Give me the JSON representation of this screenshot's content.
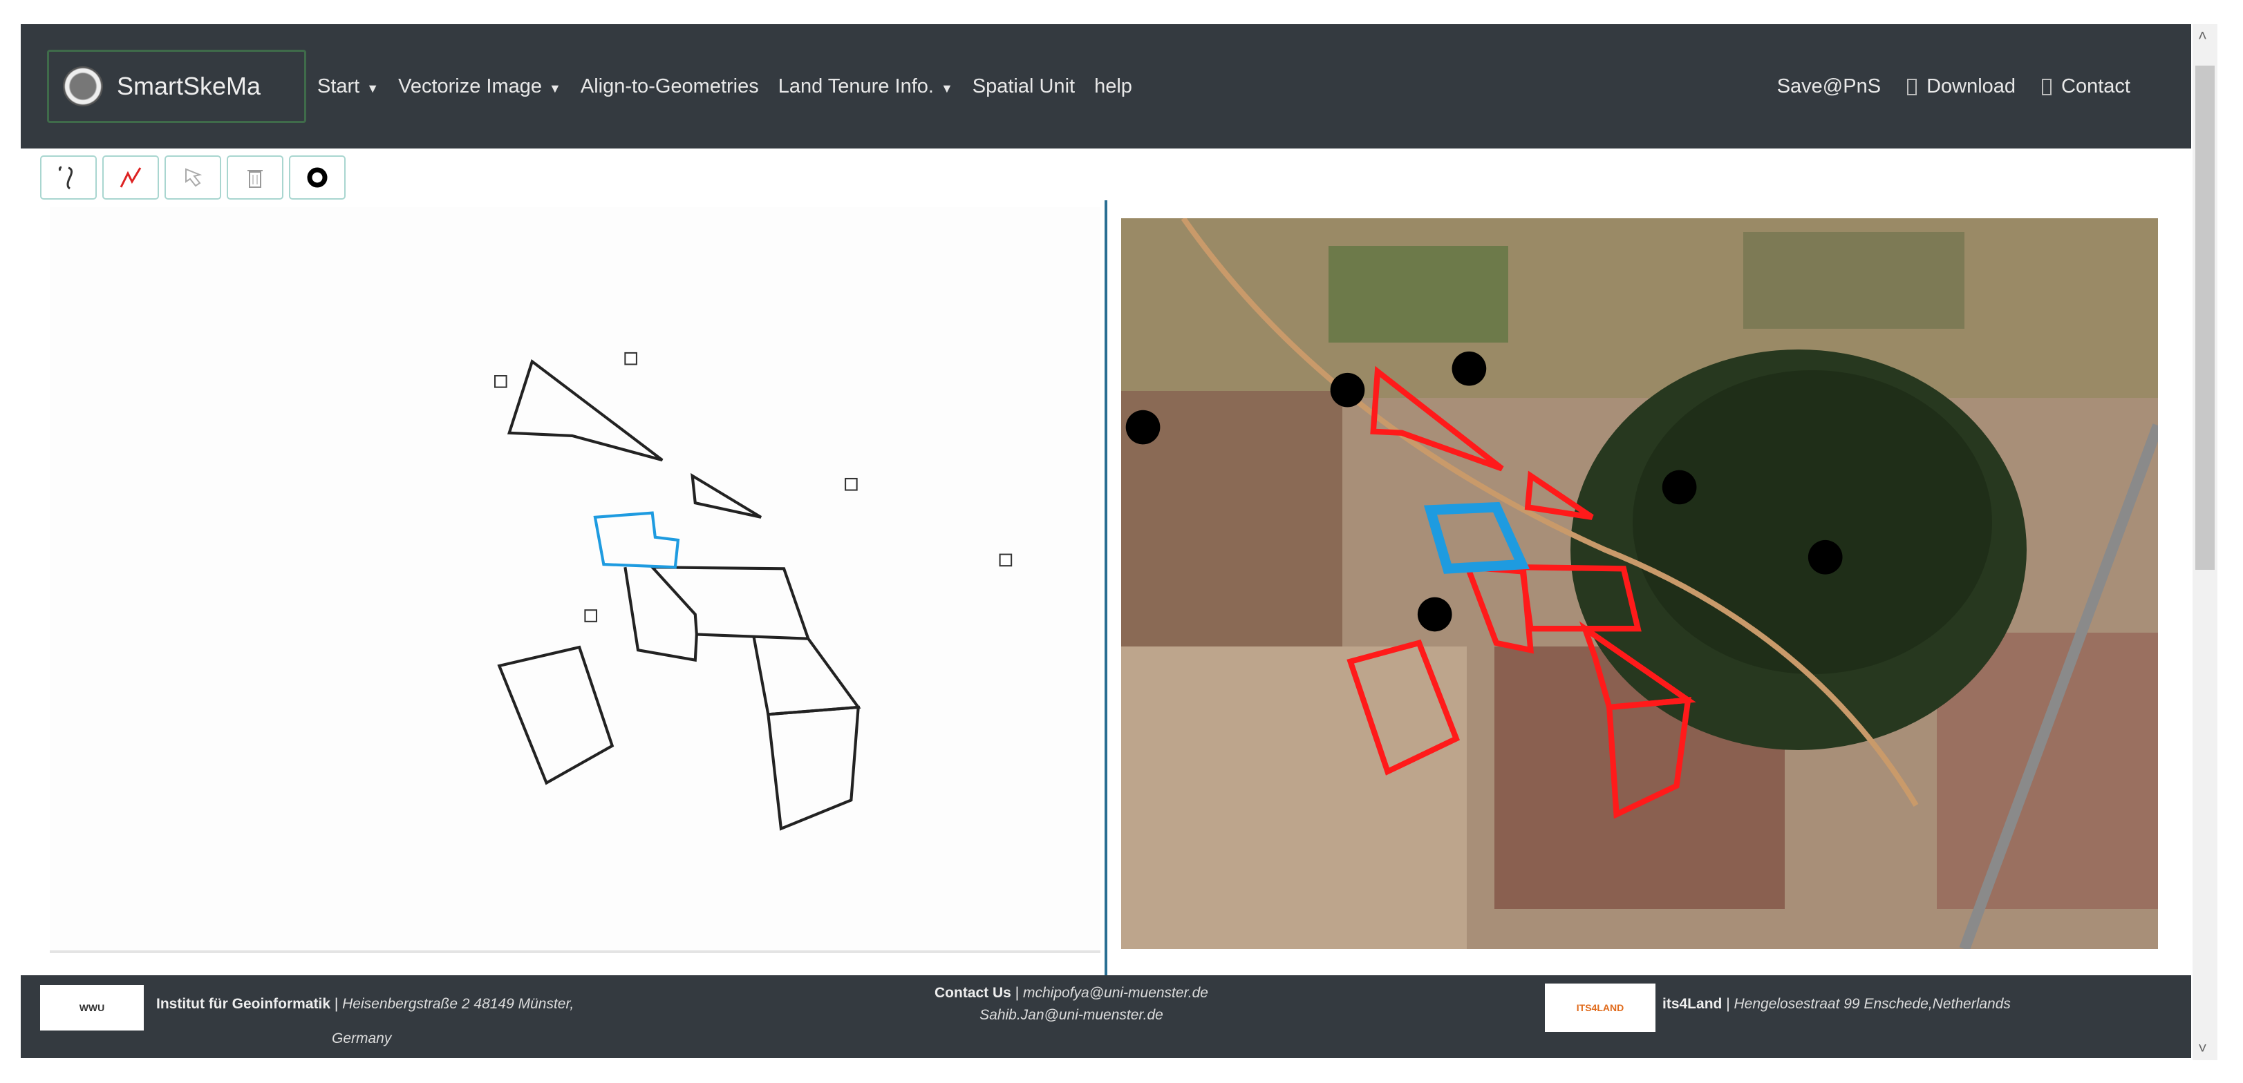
{
  "brand": "SmartSkeMa",
  "menu": [
    {
      "label": "Start",
      "dropdown": true
    },
    {
      "label": "Vectorize Image",
      "dropdown": true
    },
    {
      "label": "Align-to-Geometries",
      "dropdown": false
    },
    {
      "label": "Land Tenure Info.",
      "dropdown": true
    },
    {
      "label": "Spatial Unit",
      "dropdown": false
    },
    {
      "label": "help",
      "dropdown": false
    }
  ],
  "right_menu": {
    "save": "Save@PnS",
    "download": "Download",
    "contact": "Contact"
  },
  "toolbar": [
    {
      "icon": "freehand-line-icon"
    },
    {
      "icon": "polyline-icon"
    },
    {
      "icon": "select-pointer-icon"
    },
    {
      "icon": "trash-icon"
    },
    {
      "icon": "point-marker-icon"
    }
  ],
  "footer": {
    "ifgi_logo": "WWU",
    "ifgi_name": "Institut für Geoinformatik",
    "ifgi_sep": " | ",
    "ifgi_address": "Heisenbergstraße 2 48149 Münster,",
    "ifgi_country": "Germany",
    "contact_label": "Contact Us",
    "contact_sep": " | ",
    "email1": "mchipofya@uni-muenster.de",
    "email2": "Sahib.Jan@uni-muenster.de",
    "its_logo": "ITS4LAND",
    "its_name": "its4Land",
    "its_sep": " | ",
    "its_address": "Hengelosestraat 99 Enschede,Netherlands"
  },
  "colors": {
    "navbar": "#343a40",
    "selected": "#1e9be0",
    "aligned": "#ff1a1a",
    "sketch": "#222222"
  }
}
